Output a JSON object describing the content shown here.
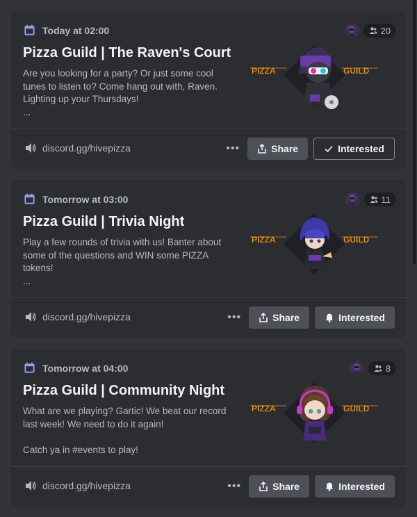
{
  "events": [
    {
      "when": "Today at 02:00",
      "title": "Pizza Guild | The Raven's Court",
      "description": "Are you looking for a party? Or just some cool\ntunes to listen to? Come hang out with, Raven.\nLighting up your Thursdays!\n...",
      "interested_count": "20",
      "location": "discord.gg/hivepizza",
      "banner_left": "PIZZA",
      "banner_right": "GUILD",
      "share_label": "Share",
      "interested_label": "Interested",
      "interested_state": "checked",
      "more_label": "•••"
    },
    {
      "when": "Tomorrow at 03:00",
      "title": "Pizza Guild | Trivia Night",
      "description": "Play a few rounds of trivia with us! Banter about\nsome of the questions and WIN some PIZZA\ntokens!\n...",
      "interested_count": "11",
      "location": "discord.gg/hivepizza",
      "banner_left": "PIZZA",
      "banner_right": "GUILD",
      "share_label": "Share",
      "interested_label": "Interested",
      "interested_state": "unset",
      "more_label": "•••"
    },
    {
      "when": "Tomorrow at 04:00",
      "title": "Pizza Guild | Community Night",
      "description": "What are we playing? Gartic! We beat our record\nlast week! We need to do it again!\n\nCatch ya in #events to play!",
      "interested_count": "8",
      "location": "discord.gg/hivepizza",
      "banner_left": "PIZZA",
      "banner_right": "GUILD",
      "share_label": "Share",
      "interested_label": "Interested",
      "interested_state": "unset",
      "more_label": "•••"
    }
  ],
  "icons": {
    "when": "calendar-icon",
    "count": "people-icon",
    "location": "stage-channel-icon",
    "share": "share-icon",
    "interested_checked": "checkmark-icon",
    "interested_unset": "bell-icon"
  },
  "colors": {
    "background": "#313338",
    "card": "#2b2d31",
    "accent_purple": "#949cf7",
    "banner_orange": "#f0a020",
    "button_gray": "#4e5058"
  }
}
